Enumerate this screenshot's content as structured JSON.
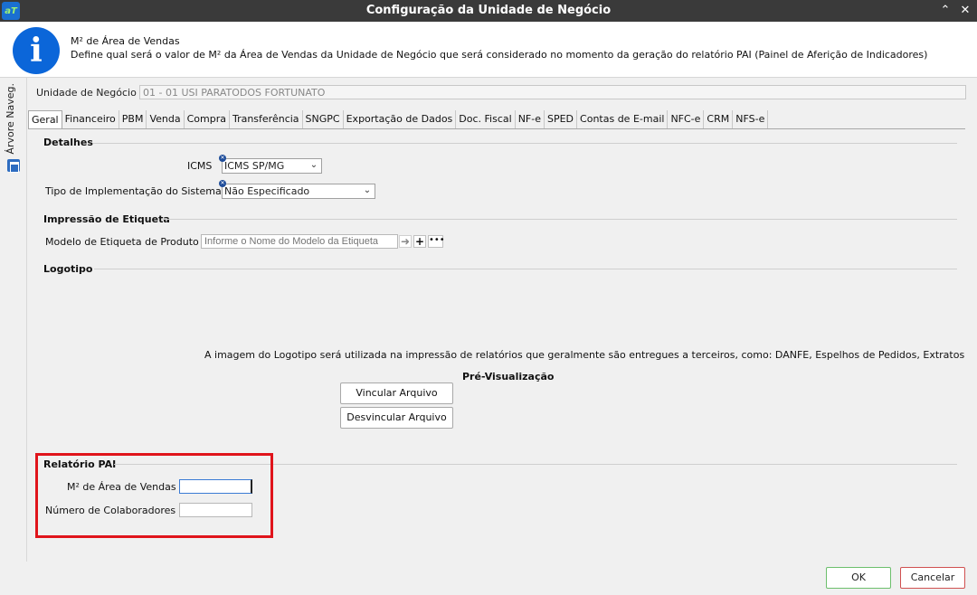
{
  "window": {
    "title": "Configuração da Unidade de Negócio",
    "app_logo": "aT",
    "collapse_icon": "chevron-up-icon",
    "close_icon": "close-icon"
  },
  "info": {
    "icon": "info-icon",
    "title": "M² de Área de Vendas",
    "description": "Define qual será o valor de M² da Área de Vendas da Unidade de Negócio que será considerado no momento da geração do relatório PAI (Painel de Aferição de Indicadores)"
  },
  "sidebar": {
    "label": "Árvore Naveg.",
    "icon": "tree-icon"
  },
  "unidade": {
    "label": "Unidade de Negócio",
    "value": "01 - 01 USI PARATODOS FORTUNATO"
  },
  "tabs": [
    {
      "label": "Geral",
      "active": true
    },
    {
      "label": "Financeiro"
    },
    {
      "label": "PBM"
    },
    {
      "label": "Venda"
    },
    {
      "label": "Compra"
    },
    {
      "label": "Transferência"
    },
    {
      "label": "SNGPC"
    },
    {
      "label": "Exportação de Dados"
    },
    {
      "label": "Doc. Fiscal"
    },
    {
      "label": "NF-e"
    },
    {
      "label": "SPED"
    },
    {
      "label": "Contas de E-mail"
    },
    {
      "label": "NFC-e"
    },
    {
      "label": "CRM"
    },
    {
      "label": "NFS-e"
    }
  ],
  "detalhes": {
    "title": "Detalhes",
    "icms_label": "ICMS",
    "icms_value": "ICMS SP/MG",
    "tipo_label": "Tipo de Implementação do Sistema",
    "tipo_value": "Não Especificado"
  },
  "etiqueta": {
    "title": "Impressão de Etiqueta",
    "modelo_label": "Modelo de Etiqueta de Produto",
    "modelo_placeholder": "Informe o Nome do Modelo da Etiqueta",
    "go_icon": "arrow-right-icon",
    "add_icon": "plus-icon",
    "more_icon": "ellipsis-icon"
  },
  "logotipo": {
    "title": "Logotipo",
    "note": "A imagem do Logotipo será utilizada na impressão de relatórios que geralmente são entregues a terceiros, como: DANFE, Espelhos de Pedidos, Extratos Finance",
    "preview_label": "Pré-Visualização",
    "vincular": "Vincular Arquivo",
    "desvincular": "Desvincular Arquivo"
  },
  "relatorio": {
    "title": "Relatório PAI",
    "m2_label": "M² de Área de Vendas",
    "m2_value": "",
    "colab_label": "Número de Colaboradores",
    "colab_value": ""
  },
  "footer": {
    "ok": "OK",
    "cancel": "Cancelar"
  },
  "colors": {
    "highlight": "#e0141b",
    "info_icon": "#0b66d9",
    "ok_border": "#6cbf6c",
    "cancel_border": "#d05050"
  }
}
